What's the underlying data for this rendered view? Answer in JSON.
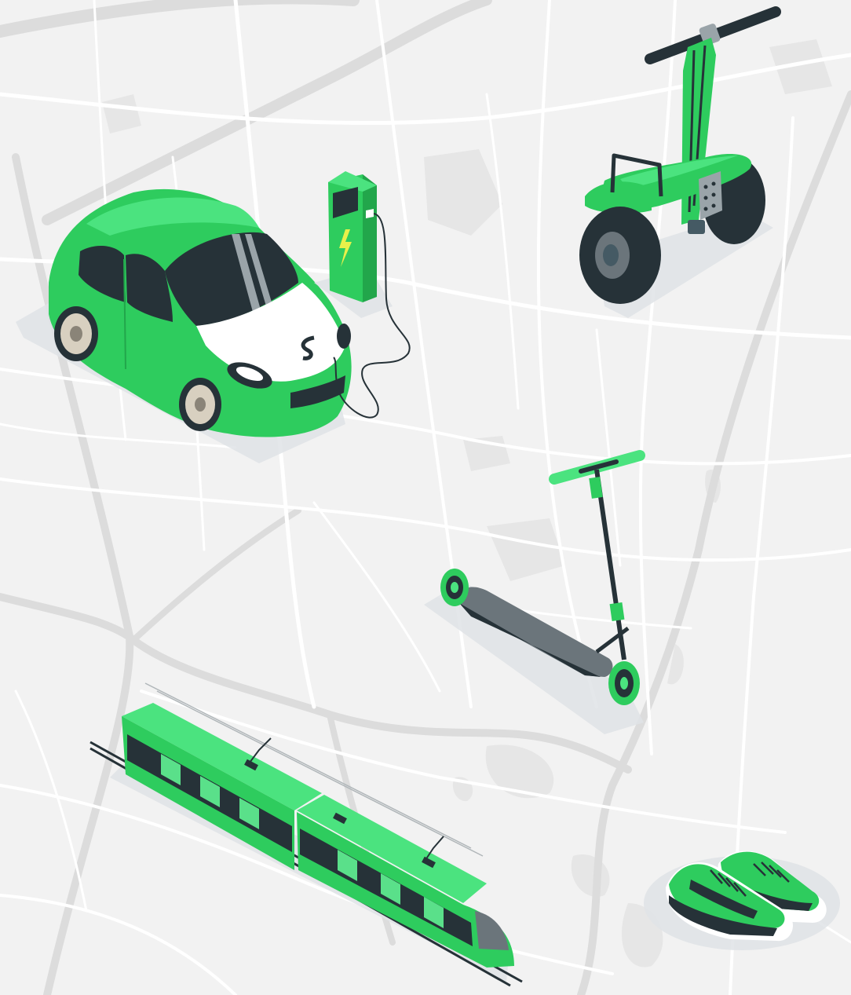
{
  "scene": {
    "background": "city-map",
    "colors": {
      "map_bg": "#f2f2f2",
      "road": "#ffffff",
      "major_road": "#dcdcdc",
      "accent_green": "#2ecc5e",
      "light_green": "#4be37f",
      "dark": "#263238",
      "grey": "#6b757b"
    },
    "illustrations": [
      {
        "name": "electric-car",
        "icon": "car-icon"
      },
      {
        "name": "charging-station",
        "icon": "charger-icon"
      },
      {
        "name": "segway",
        "icon": "segway-icon"
      },
      {
        "name": "kick-scooter",
        "icon": "scooter-icon"
      },
      {
        "name": "tram",
        "icon": "tram-icon"
      },
      {
        "name": "sneakers",
        "icon": "sneakers-icon"
      }
    ]
  }
}
